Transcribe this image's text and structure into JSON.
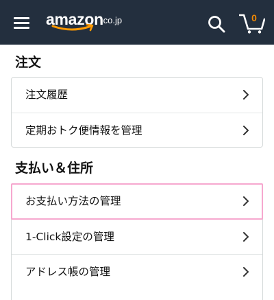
{
  "header": {
    "menu_icon": "hamburger-menu-icon",
    "logo": {
      "word": "amazon",
      "tld": ".co.jp"
    },
    "search_icon": "search-icon",
    "cart_icon": "cart-icon",
    "cart_count": "0",
    "background_color": "#232f3e",
    "cart_count_color": "#f08804"
  },
  "sections": [
    {
      "title": "注文",
      "items": [
        {
          "label": "注文履歴"
        },
        {
          "label": "定期おトク便情報を管理"
        }
      ]
    },
    {
      "title": "支払い＆住所",
      "items": [
        {
          "label": "お支払い方法の管理",
          "highlighted": true
        },
        {
          "label": "1-Click設定の管理"
        },
        {
          "label": "アドレス帳の管理"
        }
      ]
    }
  ],
  "highlight_color": "#f6a8cf",
  "chevron_icon": "chevron-right-icon"
}
